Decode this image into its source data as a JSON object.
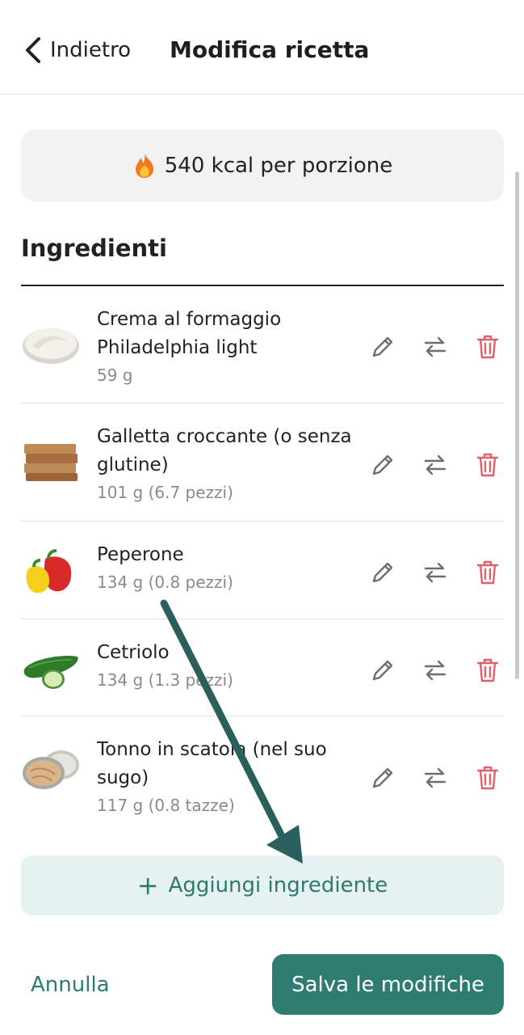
{
  "header": {
    "back_label": "Indietro",
    "title": "Modifica ricetta"
  },
  "kcal": {
    "text": "540 kcal per porzione"
  },
  "ingredients": {
    "heading": "Ingredienti",
    "items": [
      {
        "name": "Crema al formaggio Philadelphia light",
        "qty": "59 g"
      },
      {
        "name": "Galletta croccante (o senza glutine)",
        "qty": "101 g (6.7 pezzi)"
      },
      {
        "name": "Peperone",
        "qty": "134 g (0.8 pezzi)"
      },
      {
        "name": "Cetriolo",
        "qty": "134 g (1.3 pezzi)"
      },
      {
        "name": "Tonno in scatola (nel suo sugo)",
        "qty": "117 g (0.8 tazze)"
      }
    ]
  },
  "add_button": {
    "label": "Aggiungi ingrediente"
  },
  "footer": {
    "cancel_label": "Annulla",
    "save_label": "Salva le modifiche"
  },
  "colors": {
    "accent": "#2f7d72",
    "delete": "#e0606b",
    "icon_gray": "#6e6e6e",
    "arrow": "#2b5f5e"
  }
}
